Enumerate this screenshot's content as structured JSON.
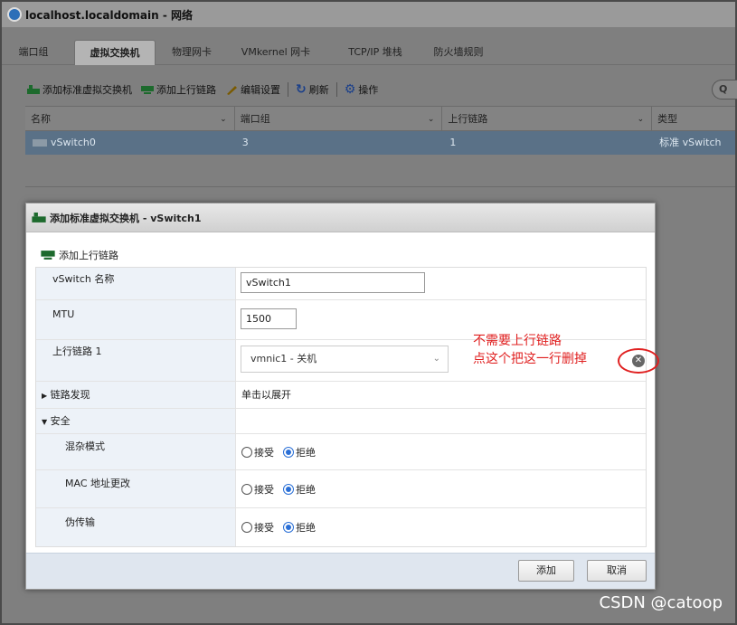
{
  "window": {
    "title": "localhost.localdomain - 网络"
  },
  "tabs": [
    {
      "label": "端口组"
    },
    {
      "label": "虚拟交换机"
    },
    {
      "label": "物理网卡"
    },
    {
      "label": "VMkernel 网卡"
    },
    {
      "label": "TCP/IP 堆栈"
    },
    {
      "label": "防火墙规则"
    }
  ],
  "toolbar": {
    "add_vswitch": "添加标准虚拟交换机",
    "add_uplink": "添加上行链路",
    "edit_settings": "编辑设置",
    "refresh": "刷新",
    "actions": "操作",
    "search_icon": "Q"
  },
  "grid": {
    "columns": [
      "名称",
      "端口组",
      "上行链路",
      "类型"
    ],
    "rows": [
      {
        "name": "vSwitch0",
        "portgroups": "3",
        "uplinks": "1",
        "type": "标准 vSwitch"
      }
    ]
  },
  "dialog": {
    "title": "添加标准虚拟交换机 - vSwitch1",
    "add_uplink": "添加上行链路",
    "fields": {
      "name_label": "vSwitch 名称",
      "name_value": "vSwitch1",
      "mtu_label": "MTU",
      "mtu_value": "1500",
      "uplink_label": "上行链路 1",
      "uplink_value": "vmnic1 - 关机",
      "discovery_label": "链路发现",
      "discovery_value": "单击以展开",
      "security_label": "安全",
      "promiscuous_label": "混杂模式",
      "mac_label": "MAC 地址更改",
      "forged_label": "伪传输",
      "accept": "接受",
      "reject": "拒绝"
    },
    "annotation": {
      "line1": "不需要上行链路",
      "line2": "点这个把这一行删掉"
    },
    "buttons": {
      "add": "添加",
      "cancel": "取消"
    }
  },
  "watermark": "CSDN @catoop",
  "colors": {
    "selected_row": "#5a7187",
    "annotation": "#e02020",
    "radio_on": "#2a6fd6"
  }
}
